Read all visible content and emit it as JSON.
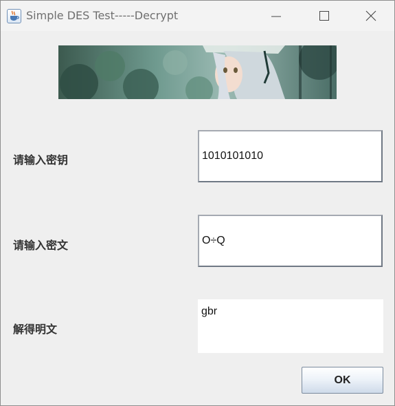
{
  "window": {
    "title": "Simple DES Test-----Decrypt",
    "app_icon": "java-coffee-cup-icon",
    "controls": [
      "minimize-icon",
      "maximize-icon",
      "close-icon"
    ]
  },
  "form": {
    "key_label": "请输入密钥",
    "key_value": "1010101010",
    "cipher_label": "请输入密文",
    "cipher_value": "O÷Q",
    "plain_label": "解得明文",
    "plain_value": "gbr"
  },
  "ok_button": {
    "label": "OK"
  },
  "colors": {
    "window_bg": "#efefef",
    "titlebar_bg": "#f3f3f3",
    "field_border": "#6f7884"
  }
}
